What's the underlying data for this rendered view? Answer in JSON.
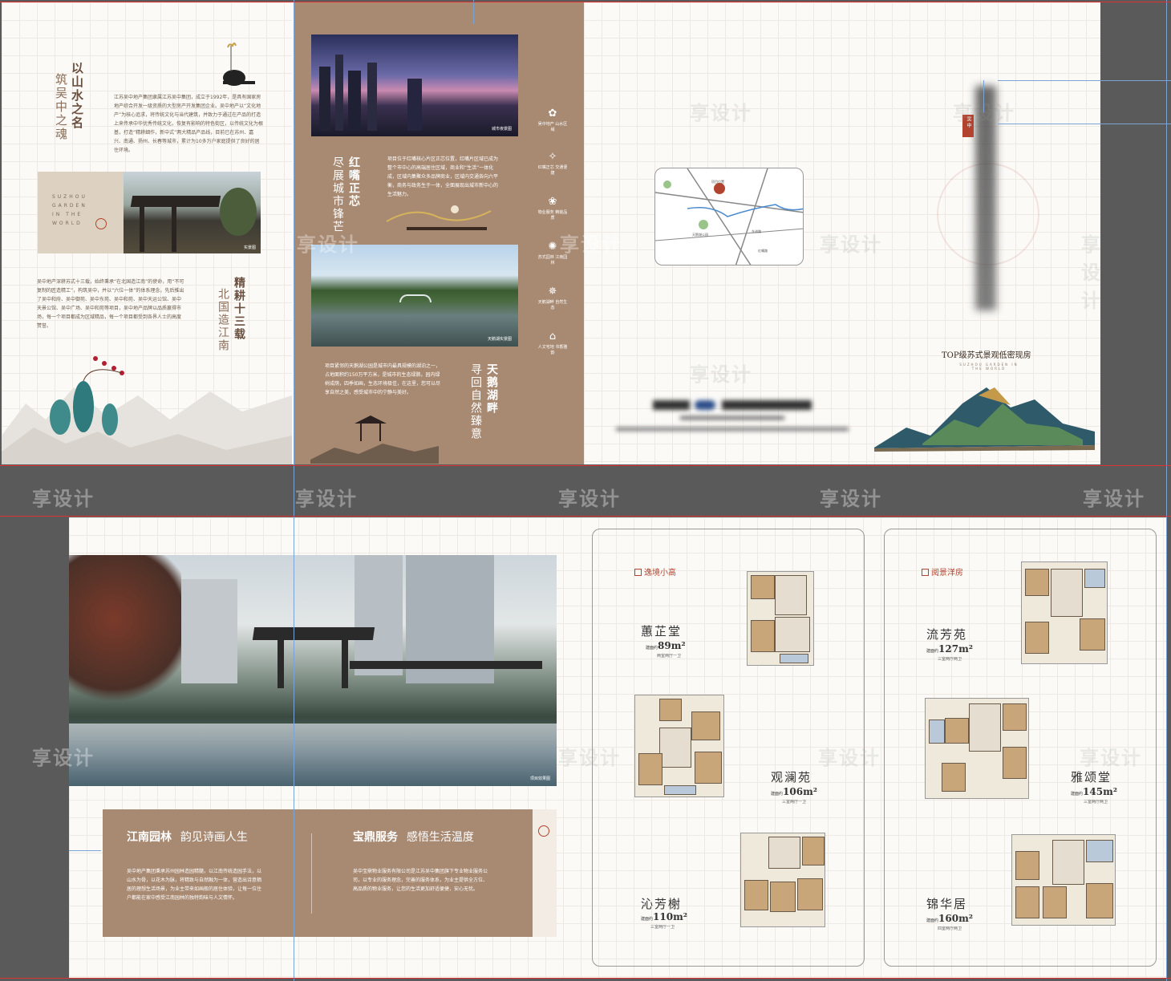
{
  "top_spread": {
    "panel1": {
      "title_a": "以山水之名",
      "title_b": "筑吴中之魂",
      "intro_text": "江苏吴中地产集团隶属江苏吴中集团，成立于1992年，是具有国家房地产综合开发一级资质的大型房产开发集团企业。吴中地产以“文化地产”为核心追求，将传统文化与当代建筑，并致力于通过在产品的打造上来传承中华优秀传统文化，恢复有影响的特色街区，以传统文化为根基，打造“精耕细作，新中式”两大精品产品线，目前已在苏州、嘉兴、南通、扬州、长春等城市，累计为10多万户家庭提供了良好的居住环境。",
      "suzhou_card": "SUZHOU GARDEN IN THE WORLD",
      "photo_caption": "实景图",
      "body_text": "吴中地产深耕苏式十三载，始终秉承“在北国造江南”的使命，用“不可复制的匠造精工”，构筑吴中，并以“六位一体”的体系理念，先后推出了吴中和府、吴中御苑、吴中东苑、吴中和苑、吴中天运公馆、吴中天景公馆、吴中广场、吴中和苑等项目，吴中地产品牌以品质赢得市场，每一个项目都成为区域精品，每一个项目都受到各界人士的高度赞誉。",
      "title2_a": "精耕十三载",
      "title2_b": "北国造江南"
    },
    "panel2": {
      "title_a": "红嘴正芯",
      "title_b": "尽展城市锋芒",
      "photo1_caption": "城市夜景图",
      "text1": "项目位于红嘴核心片区正芯位置，红嘴片区域已成为整个市中心的高端居住区域，商业和“生活”一体化成，区域内集聚众多品牌商业，区域内交通各向六平衡，商务与政务生于一体，全面展现出城市新中心的生活魅力。",
      "photo2_caption": "天鹅湖实景图",
      "text2": "项目紧邻的天鹅湖公园是城市内最具规模的湖泊之一，占地面积约150万平方米，是城市的生态绿肺。园内绿树成荫，四季如画，生态环境极佳，在这里，您可以尽享自然之美，感受城市中的宁静与美好。",
      "title2_a": "天鹅湖畔",
      "title2_b": "寻回自然臻意",
      "icons": [
        {
          "icon": "lotus-icon",
          "label": "吴中地产 山水区域"
        },
        {
          "icon": "compass-icon",
          "label": "红嘴正芯 交通便捷"
        },
        {
          "icon": "flower-icon",
          "label": "物业服务 精装品质"
        },
        {
          "icon": "gear-icon",
          "label": "苏式园林 江南园林"
        },
        {
          "icon": "star-icon",
          "label": "天鹅湖畔 自然生态"
        },
        {
          "icon": "house-icon",
          "label": "人文宅地 书香雅韵"
        }
      ]
    },
    "panel3": {
      "map_labels": [
        "东进路",
        "项目位置",
        "天鹅湖公园",
        "红嘴路"
      ]
    },
    "panel4": {
      "tagline": "TOP级苏式景观低密现房",
      "tagline_en": "SUZHOU GARDEN IN THE WORLD",
      "stamp": "吴中"
    }
  },
  "bottom_spread": {
    "hero_caption": "项目效果图",
    "box1_title": "江南园林",
    "box1_sub": "韵见诗画人生",
    "box1_text": "吴中地产集团秉承苏州园林造园精髓，以江南传统造园手法，以山水为骨，以花木为脉，将精致与自然融为一体，营造出诗意栖居的理想生活场景，为业主带来如画般的居住体验，让每一位住户都能在家中感受江南园林的独特韵味与人文情怀。",
    "box2_title": "宝鼎服务",
    "box2_sub": "感悟生活温度",
    "box2_text": "吴中宝鼎物业服务有限公司是江苏吴中集团旗下专业物业服务公司，以专业的服务理念，完善的服务体系，为业主提供全方位、高品质的物业服务，让您的生活更加舒适便捷，安心无忧。",
    "left_section": "逸境小高",
    "right_section": "阅景洋房",
    "units": [
      {
        "name": "蕙芷堂",
        "area": "89m²",
        "type": "两室两厅一卫"
      },
      {
        "name": "观澜苑",
        "area": "106m²",
        "type": "三室两厅一卫"
      },
      {
        "name": "沁芳榭",
        "area": "110m²",
        "type": "三室两厅一卫"
      },
      {
        "name": "流芳苑",
        "area": "127m²",
        "type": "三室两厅两卫"
      },
      {
        "name": "雅颂堂",
        "area": "145m²",
        "type": "三室两厅两卫"
      },
      {
        "name": "锦华居",
        "area": "160m²",
        "type": "四室两厅两卫"
      }
    ],
    "area_prefix": "建面约"
  },
  "watermark": "享设计"
}
